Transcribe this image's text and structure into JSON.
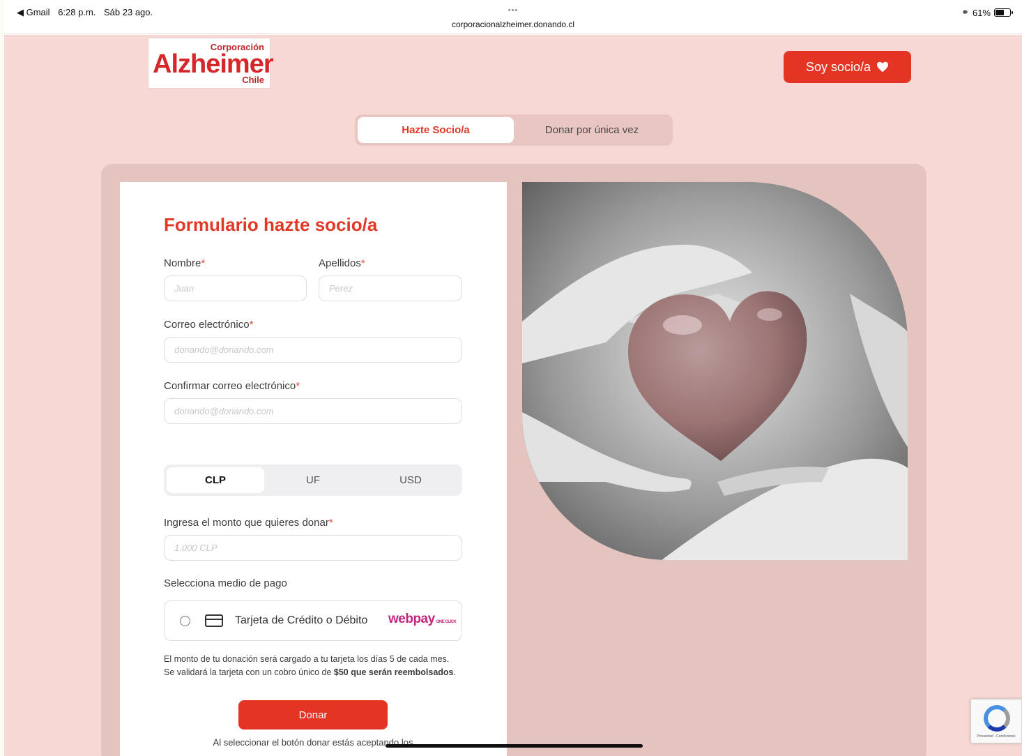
{
  "status_bar": {
    "back_app": "◀ Gmail",
    "time": "6:28 p.m.",
    "date": "Sáb 23 ago.",
    "dots": "•••",
    "url": "corporacionalzheimer.donando.cl",
    "battery_text": "61%",
    "battery_level": 0.61
  },
  "header": {
    "logo": {
      "top": "Corporación",
      "word": "Alzheimer",
      "bottom": "Chile"
    },
    "soy_socio_label": "Soy socio/a"
  },
  "tabs": [
    {
      "label": "Hazte Socio/a",
      "active": true
    },
    {
      "label": "Donar por única vez",
      "active": false
    }
  ],
  "form": {
    "title": "Formulario hazte socio/a",
    "nombre": {
      "label": "Nombre",
      "placeholder": "Juan"
    },
    "apellidos": {
      "label": "Apellidos",
      "placeholder": "Perez"
    },
    "correo": {
      "label": "Correo electrónico",
      "placeholder": "donando@donando.com"
    },
    "confirmar": {
      "label": "Confirmar correo electrónico",
      "placeholder": "donando@donando.com"
    },
    "required_mark": "*",
    "currency_tabs": [
      {
        "label": "CLP",
        "active": true
      },
      {
        "label": "UF",
        "active": false
      },
      {
        "label": "USD",
        "active": false
      }
    ],
    "monto": {
      "label": "Ingresa el monto que quieres donar",
      "placeholder": "1.000 CLP"
    },
    "pago_label": "Selecciona medio de pago",
    "pago_option": "Tarjeta de Crédito o Débito",
    "webpay": "webpay",
    "webpay_small": "ONE CLICK",
    "note_pre": "El monto de tu donación será cargado a tu tarjeta los días 5 de cada mes. Se validará la tarjeta con un cobro único de ",
    "note_bold": "$50 que serán reembolsados",
    "note_post": ".",
    "donar_label": "Donar",
    "accept_text": "Al seleccionar el botón donar estás aceptando los"
  },
  "recaptcha": {
    "text": "Privacidad - Condiciones"
  },
  "colors": {
    "brand_red": "#e43524",
    "page_bg": "#f7d8d4",
    "panel_bg": "#e5c4c0"
  }
}
